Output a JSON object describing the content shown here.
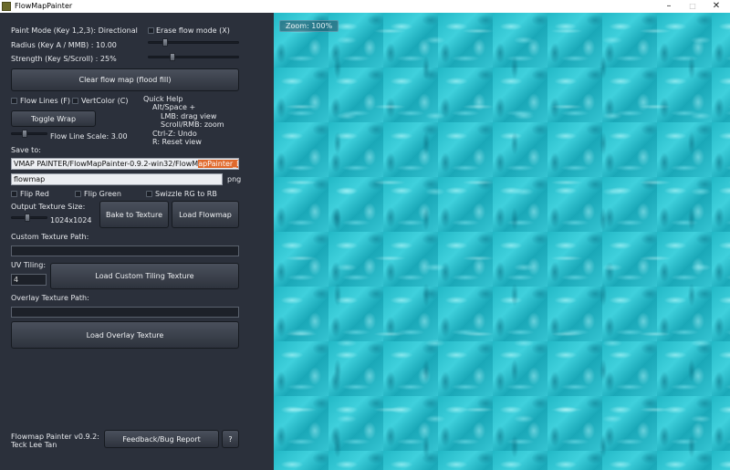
{
  "window": {
    "title": "FlowMapPainter",
    "min": "–",
    "max": "□",
    "close": "✕"
  },
  "panel": {
    "paint_mode": "Paint Mode (Key 1,2,3): Directional",
    "erase_flow": "Erase flow mode (X)",
    "radius": "Radius (Key A / MMB) : 10.00",
    "strength": "Strength (Key S/Scroll) : 25%",
    "clear_button": "Clear flow map (flood fill)",
    "flow_lines": "Flow Lines (F)",
    "vert_color": "VertColor (C)",
    "toggle_wrap": "Toggle Wrap",
    "flow_line_scale": "Flow Line Scale: 3.00",
    "quick_help": {
      "title": "Quick Help",
      "line1": "Alt/Space +",
      "line2": "LMB: drag view",
      "line3": "Scroll/RMB: zoom",
      "line4": "Ctrl-Z: Undo",
      "line5": "R: Reset view"
    },
    "save_to": "Save to:",
    "save_path_pre": "VMAP PAINTER/FlowMapPainter-0.9.2-win32/FlowM",
    "save_path_hl": "apPainter_Data",
    "filename": "flowmap",
    "ext": "png",
    "flip_red": "Flip Red",
    "flip_green": "Flip Green",
    "swizzle": "Swizzle RG to RB",
    "output_size_label": "Output Texture Size:",
    "output_size": "1024x1024",
    "bake_button": "Bake to Texture",
    "load_flowmap_button": "Load Flowmap",
    "custom_texture_label": "Custom Texture Path:",
    "custom_texture_value": "",
    "uv_tiling_label": "UV Tiling:",
    "uv_tiling_value": "4",
    "load_custom_button": "Load Custom Tiling Texture",
    "overlay_label": "Overlay Texture Path:",
    "overlay_value": "",
    "load_overlay_button": "Load Overlay Texture",
    "version_line1": "Flowmap Painter v0.9.2:",
    "version_line2": "Teck Lee Tan",
    "feedback_button": "Feedback/Bug Report",
    "help_button": "?"
  },
  "sliders": {
    "radius_level": 0.16,
    "strength_level": 0.25,
    "flow_line_scale_level": 0.35,
    "output_size_level": 0.45
  },
  "viewport": {
    "zoom": "Zoom: 100%"
  },
  "colors": {
    "panel_bg": "#2b303b",
    "water": "#2fc3d0",
    "highlight": "#e0692c"
  }
}
